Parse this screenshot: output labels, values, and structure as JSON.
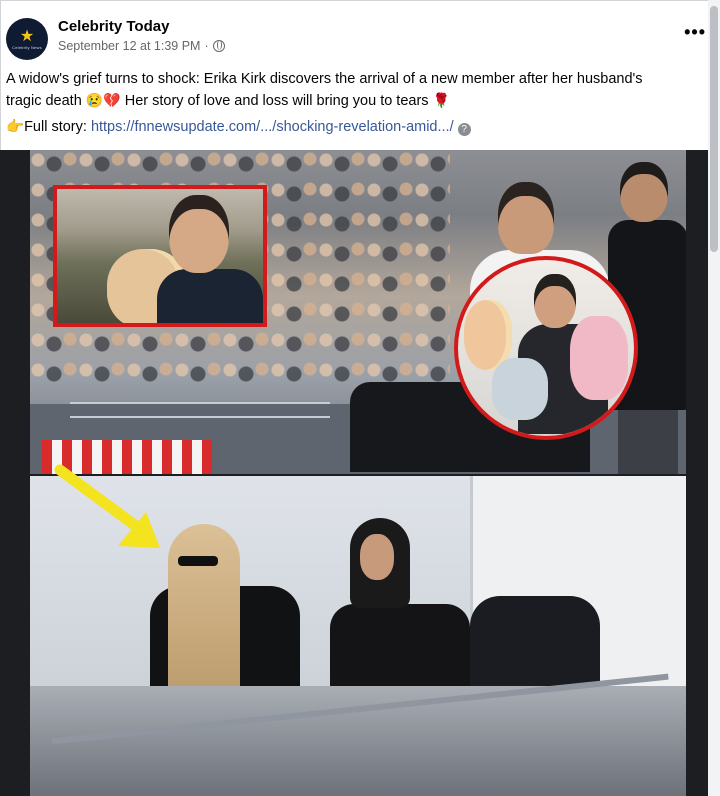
{
  "post": {
    "page_name": "Celebrity Today",
    "timestamp": "September 12 at 1:39 PM",
    "visibility_icon": "globe-icon",
    "more_label": "•••",
    "avatar_text": "Celebrity News",
    "text_line1": "A widow's grief turns to shock: Erika Kirk discovers the arrival of a new member after her husband's",
    "text_line2_start": "tragic death",
    "text_line2_emoji": "😢",
    "text_line2_heart": "💔",
    "text_line2_end": "Her story of love and loss will bring you to tears",
    "text_line2_rose": "🌹",
    "link_prefix_icon": "👉",
    "link_label": "Full story:",
    "link_url": "https://fnnewsupdate.com/.../shocking-revelation-amid.../",
    "link_help_icon": "?"
  },
  "colors": {
    "link": "#385898",
    "inset_border": "#d21a1a",
    "arrow": "#f4e31f"
  }
}
